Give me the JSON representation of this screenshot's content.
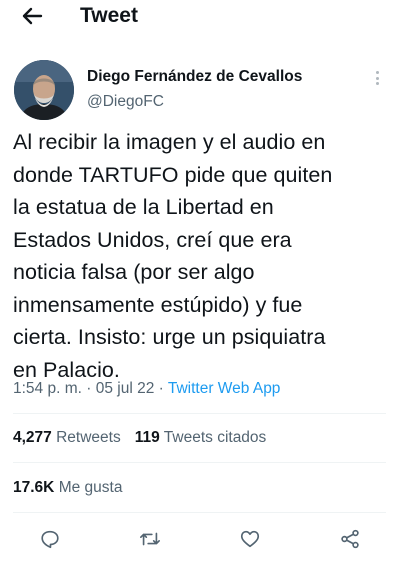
{
  "header": {
    "back_icon": "arrow-left-icon",
    "title": "Tweet"
  },
  "tweet": {
    "author": {
      "display_name": "Diego Fernández de Cevallos",
      "handle": "@DiegoFC",
      "avatar": "user-avatar"
    },
    "more_icon": "more-vertical-icon",
    "text": "Al recibir la imagen y el audio en\ndonde TARTUFO pide que quiten\nla estatua de la Libertad en\nEstados Unidos, creí que era\nnoticia falsa (por ser algo\ninmensamente estúpido) y fue\ncierta. Insisto: urge un psiquiatra\nen Palacio.",
    "time": "1:54 p. m.",
    "date": "05 jul 22",
    "source": "Twitter Web App",
    "separator": "·"
  },
  "stats": {
    "retweets_count": "4,277",
    "retweets_label": "Retweets",
    "quotes_count": "119",
    "quotes_label": "Tweets citados",
    "likes_count": "17.6K",
    "likes_label": "Me gusta"
  },
  "actions": [
    {
      "icon": "reply-icon"
    },
    {
      "icon": "retweet-icon"
    },
    {
      "icon": "like-icon"
    },
    {
      "icon": "share-icon"
    }
  ],
  "colors": {
    "text": "#0f1419",
    "secondary": "#536471",
    "link": "#1d9bf0",
    "divider": "#eff3f4"
  }
}
